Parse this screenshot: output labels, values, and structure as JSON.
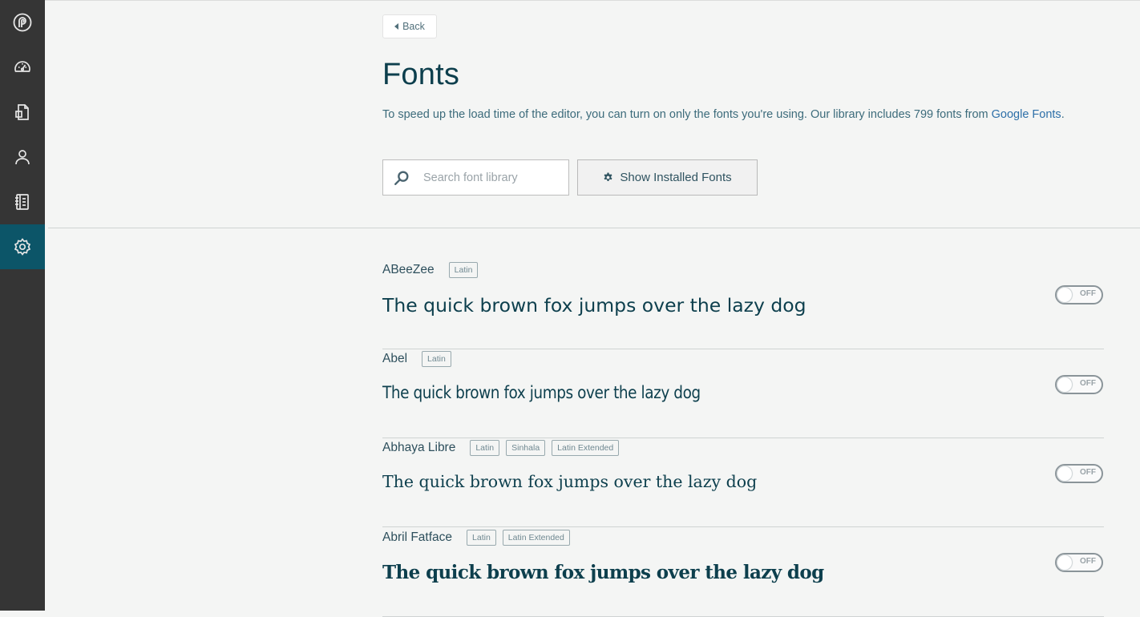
{
  "sidebar": {
    "items": [
      {
        "name": "logo",
        "icon": "pagecloud-logo-icon"
      },
      {
        "name": "dashboard",
        "icon": "speedometer-icon"
      },
      {
        "name": "pages",
        "icon": "document-icon"
      },
      {
        "name": "account",
        "icon": "user-icon"
      },
      {
        "name": "guide",
        "icon": "notebook-icon"
      },
      {
        "name": "settings",
        "icon": "gear-icon",
        "active": true
      }
    ],
    "accent": "#0c5568"
  },
  "header": {
    "back_label": "Back",
    "title": "Fonts",
    "intro_text": "To speed up the load time of the editor, you can turn on only the fonts you're using. Our library includes 799 fonts from ",
    "intro_link": "Google Fonts",
    "intro_end": "."
  },
  "search": {
    "placeholder": "Search font library",
    "value": ""
  },
  "show_installed_label": "Show Installed Fonts",
  "sample_text": "The quick brown fox jumps over the lazy dog",
  "fonts": [
    {
      "name": "ABeeZee",
      "tags": [
        "Latin"
      ],
      "toggle": "OFF"
    },
    {
      "name": "Abel",
      "tags": [
        "Latin"
      ],
      "toggle": "OFF"
    },
    {
      "name": "Abhaya Libre",
      "tags": [
        "Latin",
        "Sinhala",
        "Latin Extended"
      ],
      "toggle": "OFF"
    },
    {
      "name": "Abril Fatface",
      "tags": [
        "Latin",
        "Latin Extended"
      ],
      "toggle": "OFF"
    }
  ]
}
